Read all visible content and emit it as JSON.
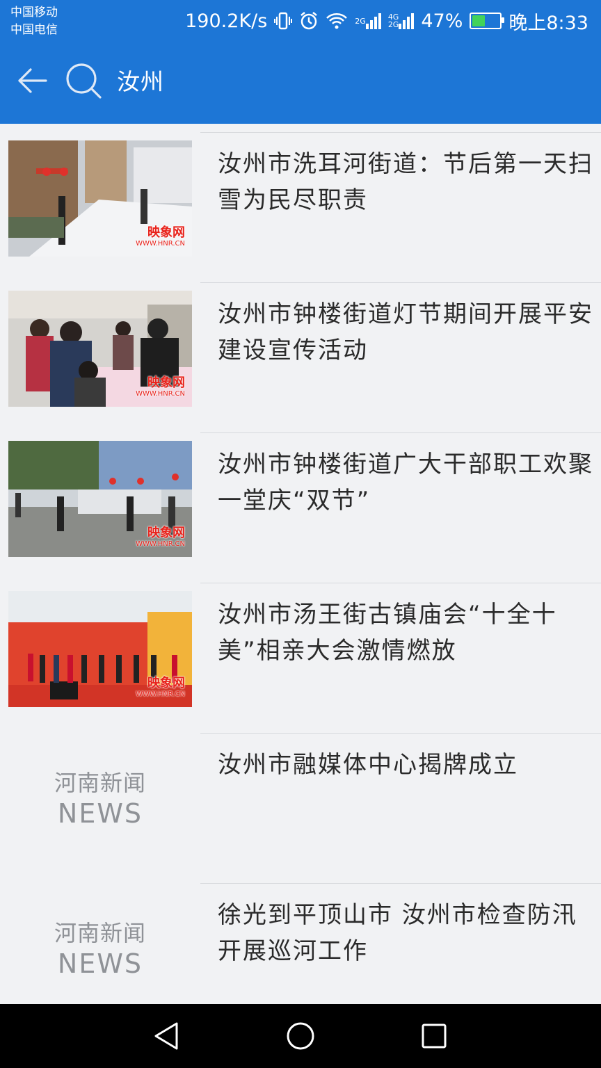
{
  "status_bar": {
    "carrier_1": "中国移动",
    "carrier_2": "中国电信",
    "net_speed": "190.2K/s",
    "sim1_net": "2G",
    "sim2_net_top": "4G",
    "sim2_net_bottom": "2G",
    "battery": "47%",
    "battery_level": 0.47,
    "time": "晚上8:33",
    "icons": [
      "vibrate-icon",
      "alarm-icon",
      "wifi-icon",
      "signal-icon",
      "battery-icon"
    ]
  },
  "header": {
    "query": "汝州",
    "back_icon": "back-arrow-icon",
    "search_icon": "search-icon"
  },
  "colors": {
    "header_bg": "#1d76d6",
    "list_bg": "#f1f2f4",
    "watermark": "#e8221b"
  },
  "results": [
    {
      "title": "汝州市洗耳河街道：节后第一天扫雪为民尽职责",
      "thumbnail": "photo",
      "watermark": "映象网",
      "watermark_url": "WWW.HNR.CN"
    },
    {
      "title": "汝州市钟楼街道灯节期间开展平安建设宣传活动",
      "thumbnail": "photo",
      "watermark": "映象网",
      "watermark_url": "WWW.HNR.CN"
    },
    {
      "title": "汝州市钟楼街道广大干部职工欢聚一堂庆“双节”",
      "thumbnail": "photo",
      "watermark": "映象网",
      "watermark_url": "WWW.HNR.CN"
    },
    {
      "title": "汝州市汤王街古镇庙会“十全十美”相亲大会激情燃放",
      "thumbnail": "photo",
      "watermark": "映象网",
      "watermark_url": "WWW.HNR.CN"
    },
    {
      "title": "汝州市融媒体中心揭牌成立",
      "thumbnail": "placeholder",
      "placeholder_line1": "河南新闻",
      "placeholder_line2": "NEWS"
    },
    {
      "title": "徐光到平顶山市 汝州市检查防汛开展巡河工作",
      "thumbnail": "placeholder",
      "placeholder_line1": "河南新闻",
      "placeholder_line2": "NEWS"
    }
  ],
  "nav_bar": {
    "back": "nav-back-icon",
    "home": "nav-home-icon",
    "recents": "nav-recents-icon"
  }
}
